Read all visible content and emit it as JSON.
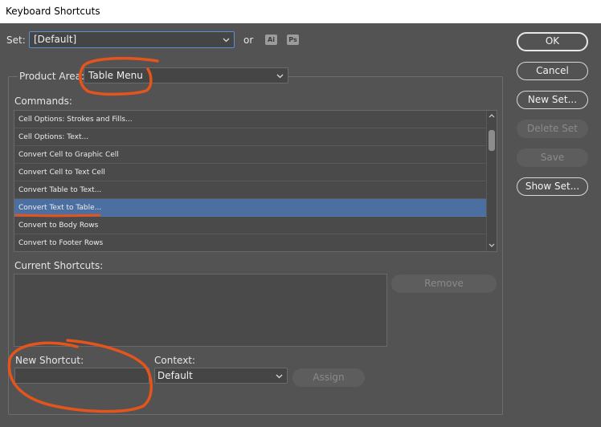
{
  "window": {
    "title": "Keyboard Shortcuts"
  },
  "set": {
    "label": "Set:",
    "value": "[Default]",
    "or_label": "or",
    "app_badges": [
      "Ai",
      "Ps"
    ]
  },
  "product_area": {
    "label": "Product Area:",
    "value": "Table Menu"
  },
  "commands": {
    "label": "Commands:",
    "items": [
      "Cell Options: Strokes and Fills...",
      "Cell Options: Text...",
      "Convert Cell to Graphic Cell",
      "Convert Cell to Text Cell",
      "Convert Table to Text...",
      "Convert Text to Table...",
      "Convert to Body Rows",
      "Convert to Footer Rows"
    ],
    "selected_index": 5
  },
  "current_shortcuts": {
    "label": "Current Shortcuts:",
    "remove_label": "Remove"
  },
  "new_shortcut": {
    "label": "New Shortcut:",
    "value": ""
  },
  "context": {
    "label": "Context:",
    "value": "Default"
  },
  "assign_label": "Assign",
  "buttons": {
    "ok": "OK",
    "cancel": "Cancel",
    "new_set": "New Set...",
    "delete_set": "Delete Set",
    "save": "Save",
    "show_set": "Show Set..."
  },
  "colors": {
    "background": "#535353",
    "selection": "#4b6fa0",
    "annotation": "#e5541c"
  }
}
